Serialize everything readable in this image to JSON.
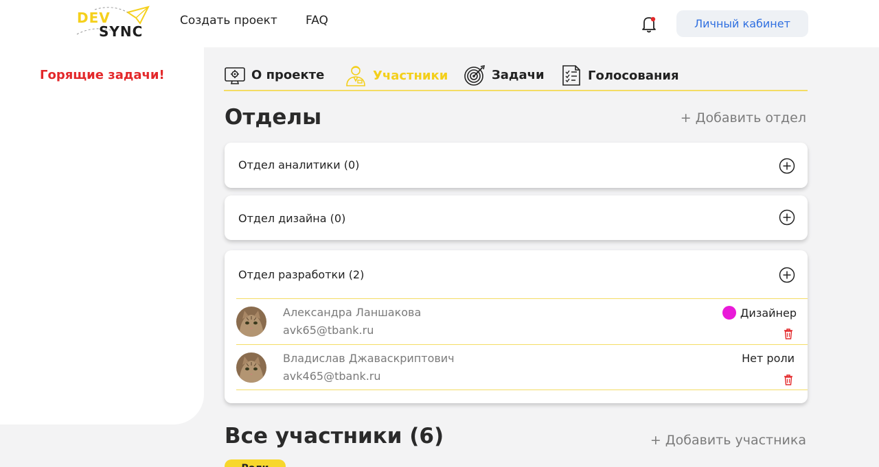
{
  "header": {
    "logo": {
      "top": "DEV",
      "bottom": "SYNC"
    },
    "nav": [
      {
        "label": "Создать проект"
      },
      {
        "label": "FAQ"
      }
    ],
    "cabinet_button": "Личный кабинет",
    "notification_icon": "bell-icon"
  },
  "sidebar": {
    "hot_tasks": "Горящие задачи!"
  },
  "tabs": [
    {
      "label": "О проекте",
      "icon": "monitor-gear-icon",
      "active": false
    },
    {
      "label": "Участники",
      "icon": "person-icon",
      "active": true
    },
    {
      "label": "Задачи",
      "icon": "target-icon",
      "active": false
    },
    {
      "label": "Голосования",
      "icon": "checklist-icon",
      "active": false
    }
  ],
  "departments_section": {
    "title": "Отделы",
    "add_label": "+ Добавить отдел",
    "departments": [
      {
        "name": "Отдел аналитики (0)"
      },
      {
        "name": "Отдел дизайна (0)"
      },
      {
        "name": "Отдел разработки (2)",
        "members": [
          {
            "name": "Александра Ланшакова",
            "email": "avk65@tbank.ru",
            "role": "Дизайнер",
            "role_color": "#e91ad8"
          },
          {
            "name": "Владислав Джаваскриптович",
            "email": "avk465@tbank.ru",
            "role": "Нет роли"
          }
        ]
      }
    ]
  },
  "all_members_section": {
    "title": "Все участники (6)",
    "add_label": "+ Добавить участника",
    "roles_button": "Роли"
  },
  "colors": {
    "accent_yellow": "#f3cf1b",
    "alert_red": "#e3282a",
    "link_blue": "#2f6fe0"
  }
}
